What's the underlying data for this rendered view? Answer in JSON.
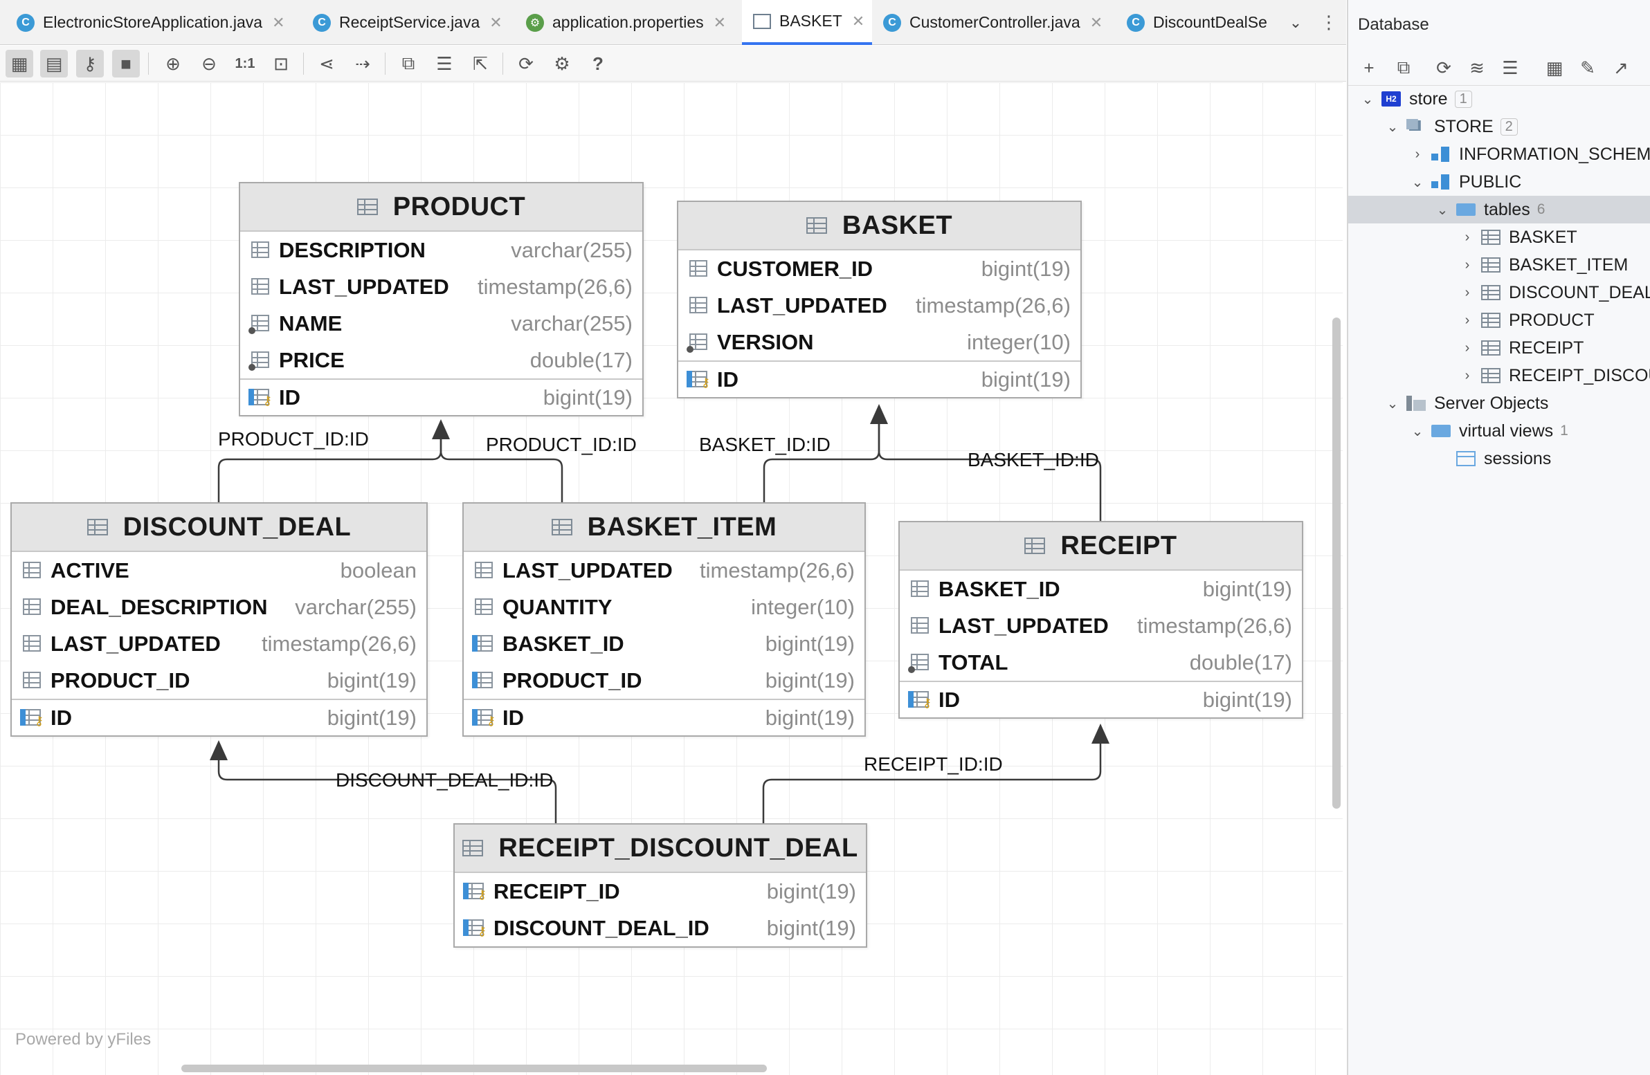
{
  "tabs": [
    {
      "label": "ElectronicStoreApplication.java",
      "icon": "java-class-icon"
    },
    {
      "label": "ReceiptService.java",
      "icon": "java-class-icon"
    },
    {
      "label": "application.properties",
      "icon": "properties-icon"
    },
    {
      "label": "BASKET",
      "icon": "diagram-icon"
    },
    {
      "label": "CustomerController.java",
      "icon": "java-class-icon"
    },
    {
      "label": "DiscountDealSe",
      "icon": "java-class-icon"
    }
  ],
  "toolbar": {
    "actual_size_label": "1:1",
    "help_label": "?"
  },
  "entities": {
    "product": {
      "name": "PRODUCT",
      "columns": [
        {
          "name": "DESCRIPTION",
          "type": "varchar(255)"
        },
        {
          "name": "LAST_UPDATED",
          "type": "timestamp(26,6)"
        },
        {
          "name": "NAME",
          "type": "varchar(255)"
        },
        {
          "name": "PRICE",
          "type": "double(17)"
        }
      ],
      "pk": {
        "name": "ID",
        "type": "bigint(19)"
      }
    },
    "basket": {
      "name": "BASKET",
      "columns": [
        {
          "name": "CUSTOMER_ID",
          "type": "bigint(19)"
        },
        {
          "name": "LAST_UPDATED",
          "type": "timestamp(26,6)"
        },
        {
          "name": "VERSION",
          "type": "integer(10)"
        }
      ],
      "pk": {
        "name": "ID",
        "type": "bigint(19)"
      }
    },
    "discount_deal": {
      "name": "DISCOUNT_DEAL",
      "columns": [
        {
          "name": "ACTIVE",
          "type": "boolean"
        },
        {
          "name": "DEAL_DESCRIPTION",
          "type": "varchar(255)"
        },
        {
          "name": "LAST_UPDATED",
          "type": "timestamp(26,6)"
        },
        {
          "name": "PRODUCT_ID",
          "type": "bigint(19)"
        }
      ],
      "pk": {
        "name": "ID",
        "type": "bigint(19)"
      }
    },
    "basket_item": {
      "name": "BASKET_ITEM",
      "columns": [
        {
          "name": "LAST_UPDATED",
          "type": "timestamp(26,6)"
        },
        {
          "name": "QUANTITY",
          "type": "integer(10)"
        },
        {
          "name": "BASKET_ID",
          "type": "bigint(19)"
        },
        {
          "name": "PRODUCT_ID",
          "type": "bigint(19)"
        }
      ],
      "pk": {
        "name": "ID",
        "type": "bigint(19)"
      }
    },
    "receipt": {
      "name": "RECEIPT",
      "columns": [
        {
          "name": "BASKET_ID",
          "type": "bigint(19)"
        },
        {
          "name": "LAST_UPDATED",
          "type": "timestamp(26,6)"
        },
        {
          "name": "TOTAL",
          "type": "double(17)"
        }
      ],
      "pk": {
        "name": "ID",
        "type": "bigint(19)"
      }
    },
    "receipt_discount_deal": {
      "name": "RECEIPT_DISCOUNT_DEAL",
      "columns": [
        {
          "name": "RECEIPT_ID",
          "type": "bigint(19)"
        },
        {
          "name": "DISCOUNT_DEAL_ID",
          "type": "bigint(19)"
        }
      ]
    }
  },
  "relations": {
    "discount_deal_product": "PRODUCT_ID:ID",
    "basket_item_product": "PRODUCT_ID:ID",
    "basket_item_basket": "BASKET_ID:ID",
    "receipt_basket": "BASKET_ID:ID",
    "rdd_discount_deal": "DISCOUNT_DEAL_ID:ID",
    "rdd_receipt": "RECEIPT_ID:ID"
  },
  "powered_by": "Powered by yFiles",
  "database_panel": {
    "title": "Database",
    "tree": [
      {
        "label": "store",
        "badge": "1",
        "icon": "h2-database-icon"
      },
      {
        "label": "STORE",
        "badge": "2",
        "icon": "database-icon"
      },
      {
        "label": "INFORMATION_SCHEMA",
        "icon": "schema-icon"
      },
      {
        "label": "PUBLIC",
        "icon": "schema-icon"
      },
      {
        "label": "tables",
        "count": "6",
        "icon": "folder-icon"
      },
      {
        "label": "BASKET",
        "icon": "table-icon"
      },
      {
        "label": "BASKET_ITEM",
        "icon": "table-icon"
      },
      {
        "label": "DISCOUNT_DEAL",
        "icon": "table-icon"
      },
      {
        "label": "PRODUCT",
        "icon": "table-icon"
      },
      {
        "label": "RECEIPT",
        "icon": "table-icon"
      },
      {
        "label": "RECEIPT_DISCOUNT_DEAL",
        "icon": "table-icon"
      },
      {
        "label": "Server Objects",
        "icon": "server-objects-icon"
      },
      {
        "label": "virtual views",
        "count": "1",
        "icon": "folder-icon"
      },
      {
        "label": "sessions",
        "icon": "view-icon"
      }
    ]
  }
}
